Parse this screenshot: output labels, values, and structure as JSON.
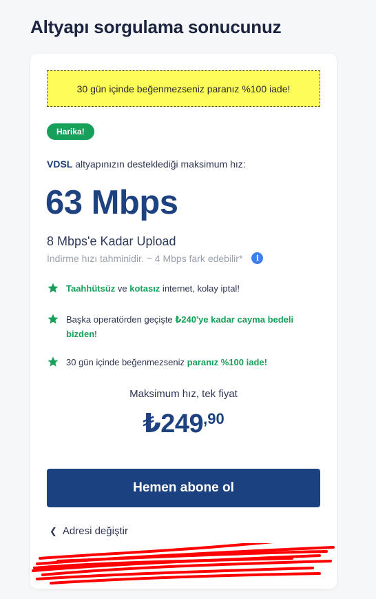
{
  "page": {
    "title": "Altyapı sorgulama sonucunuz"
  },
  "banner": {
    "text": "30 gün içinde beğenmezseniz paranız %100 iade!"
  },
  "badge": {
    "text": "Harika!"
  },
  "speed": {
    "tech": "VDSL",
    "intro_rest": " altyapınızın desteklediği maksimum hız:",
    "value": "63 Mbps",
    "upload": "8 Mbps'e Kadar Upload",
    "estimate": "İndirme hızı tahminidir. ~ 4 Mbps fark edebilir*"
  },
  "features": {
    "f1": {
      "a": "Taahhütsüz",
      "b": " ve ",
      "c": "kotasız",
      "d": " internet, kolay iptal!"
    },
    "f2": {
      "a": "Başka operatörden geçişte ",
      "b": "₺240'ye kadar cayma bedeli bizden",
      "c": "!"
    },
    "f3": {
      "a": "30 gün içinde beğenmezseniz ",
      "b": "paranız %100 iade!"
    }
  },
  "price": {
    "label": "Maksimum hız, tek fiyat",
    "main": "₺249",
    "cents": ",90"
  },
  "actions": {
    "subscribe": "Hemen abone ol",
    "change_address": "Adresi değiştir"
  },
  "icons": {
    "star": "star-icon",
    "info": "info-icon",
    "chevron": "chevron-left-icon"
  },
  "colors": {
    "brand": "#1c4180",
    "accent_green": "#17a05a",
    "banner_yellow": "#fdfd59",
    "scribble_red": "#ff0000"
  }
}
